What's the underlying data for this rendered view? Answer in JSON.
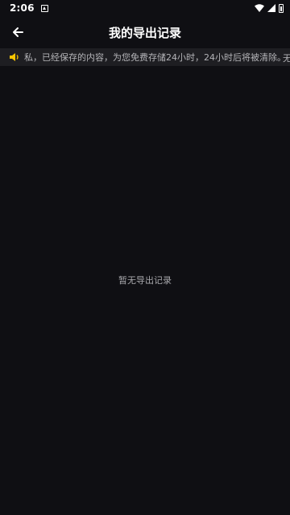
{
  "status_bar": {
    "time": "2:06"
  },
  "header": {
    "title": "我的导出记录"
  },
  "notice": {
    "text": "私，已经保存的内容，为您免费存储24小时，24小时后将被清除。",
    "trail": "无"
  },
  "empty_state": {
    "text": "暂无导出记录"
  },
  "icons": {
    "back": "arrow-left-icon",
    "speaker": "speaker-icon",
    "wifi": "wifi-icon",
    "signal": "signal-icon",
    "battery": "battery-icon",
    "notification": "app-notification-icon"
  },
  "colors": {
    "background": "#0f0f13",
    "notice_background": "#1e1e22",
    "accent": "#f5c400",
    "text_secondary": "#a8a8ac"
  }
}
